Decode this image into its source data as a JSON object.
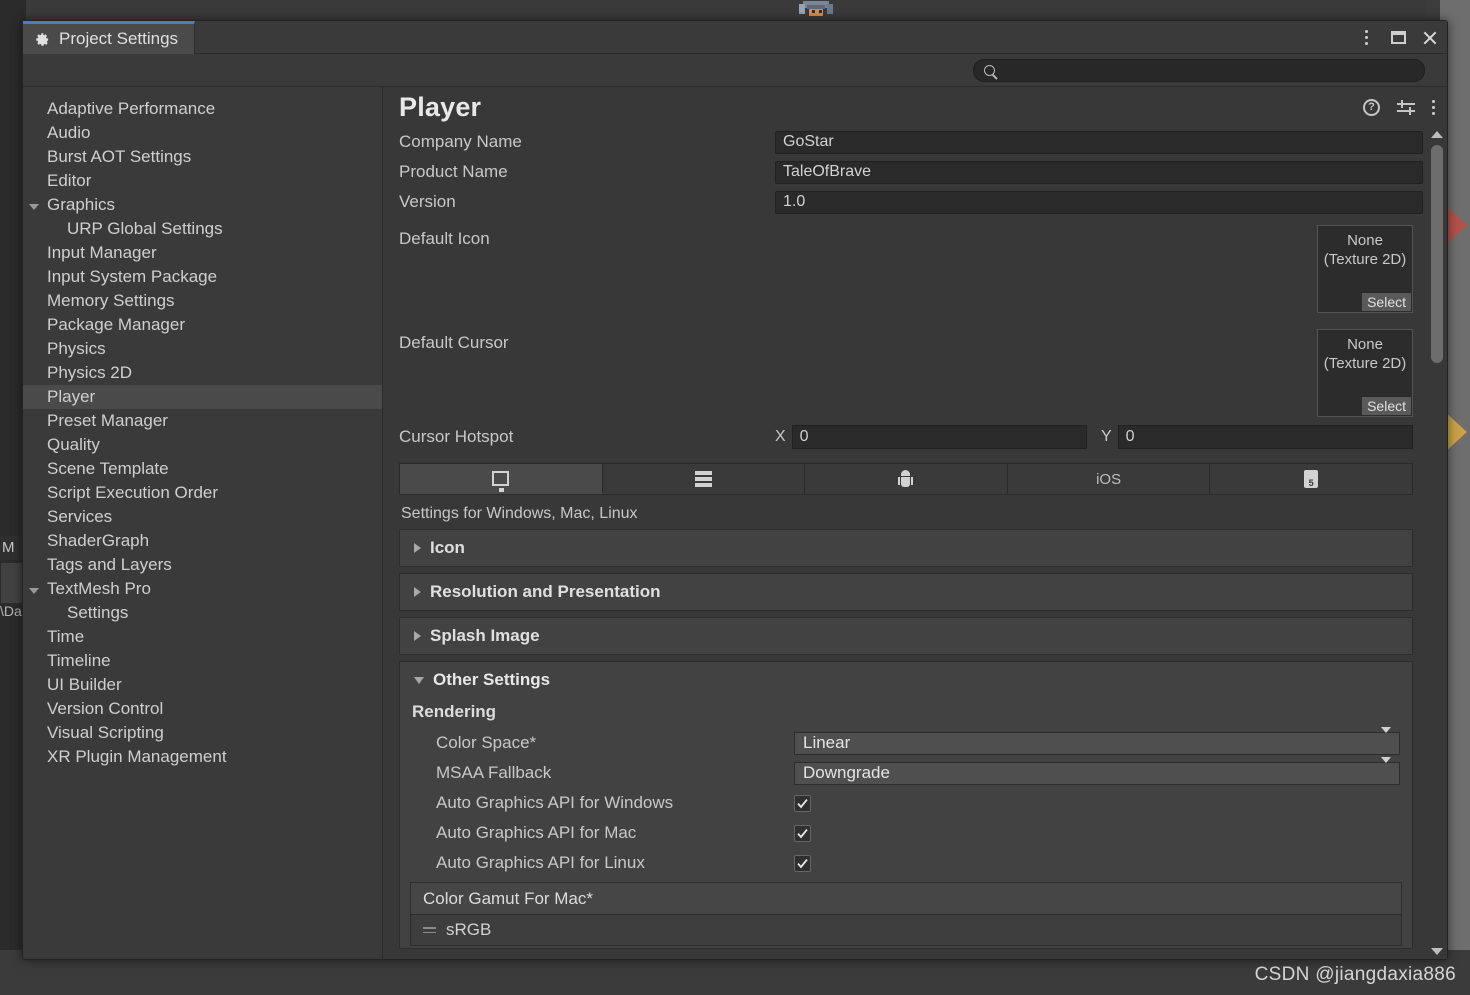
{
  "window": {
    "tab_title": "Project Settings",
    "tab_icon": "gear-icon",
    "controls": {
      "menu": "kebab-menu-icon",
      "maximize": "maximize-icon",
      "close": "close-icon"
    }
  },
  "search": {
    "placeholder": "",
    "value": "",
    "icon": "search-icon"
  },
  "sidebar": {
    "items": [
      {
        "label": "Adaptive Performance",
        "level": 0,
        "expanded": null,
        "selected": false
      },
      {
        "label": "Audio",
        "level": 0,
        "expanded": null,
        "selected": false
      },
      {
        "label": "Burst AOT Settings",
        "level": 0,
        "expanded": null,
        "selected": false
      },
      {
        "label": "Editor",
        "level": 0,
        "expanded": null,
        "selected": false
      },
      {
        "label": "Graphics",
        "level": 0,
        "expanded": true,
        "selected": false
      },
      {
        "label": "URP Global Settings",
        "level": 1,
        "expanded": null,
        "selected": false
      },
      {
        "label": "Input Manager",
        "level": 0,
        "expanded": null,
        "selected": false
      },
      {
        "label": "Input System Package",
        "level": 0,
        "expanded": null,
        "selected": false
      },
      {
        "label": "Memory Settings",
        "level": 0,
        "expanded": null,
        "selected": false
      },
      {
        "label": "Package Manager",
        "level": 0,
        "expanded": null,
        "selected": false
      },
      {
        "label": "Physics",
        "level": 0,
        "expanded": null,
        "selected": false
      },
      {
        "label": "Physics 2D",
        "level": 0,
        "expanded": null,
        "selected": false
      },
      {
        "label": "Player",
        "level": 0,
        "expanded": null,
        "selected": true
      },
      {
        "label": "Preset Manager",
        "level": 0,
        "expanded": null,
        "selected": false
      },
      {
        "label": "Quality",
        "level": 0,
        "expanded": null,
        "selected": false
      },
      {
        "label": "Scene Template",
        "level": 0,
        "expanded": null,
        "selected": false
      },
      {
        "label": "Script Execution Order",
        "level": 0,
        "expanded": null,
        "selected": false
      },
      {
        "label": "Services",
        "level": 0,
        "expanded": null,
        "selected": false
      },
      {
        "label": "ShaderGraph",
        "level": 0,
        "expanded": null,
        "selected": false
      },
      {
        "label": "Tags and Layers",
        "level": 0,
        "expanded": null,
        "selected": false
      },
      {
        "label": "TextMesh Pro",
        "level": 0,
        "expanded": true,
        "selected": false
      },
      {
        "label": "Settings",
        "level": 1,
        "expanded": null,
        "selected": false
      },
      {
        "label": "Time",
        "level": 0,
        "expanded": null,
        "selected": false
      },
      {
        "label": "Timeline",
        "level": 0,
        "expanded": null,
        "selected": false
      },
      {
        "label": "UI Builder",
        "level": 0,
        "expanded": null,
        "selected": false
      },
      {
        "label": "Version Control",
        "level": 0,
        "expanded": null,
        "selected": false
      },
      {
        "label": "Visual Scripting",
        "level": 0,
        "expanded": null,
        "selected": false
      },
      {
        "label": "XR Plugin Management",
        "level": 0,
        "expanded": null,
        "selected": false
      }
    ]
  },
  "panel": {
    "title": "Player",
    "icons": {
      "help": "help-icon",
      "preset": "preset-icon",
      "menu": "kebab-menu-icon"
    },
    "fields": {
      "company_name": {
        "label": "Company Name",
        "value": "GoStar"
      },
      "product_name": {
        "label": "Product Name",
        "value": "TaleOfBrave"
      },
      "version": {
        "label": "Version",
        "value": "1.0"
      }
    },
    "default_icon": {
      "label": "Default Icon",
      "value_line1": "None",
      "value_line2": "(Texture 2D)",
      "select_label": "Select"
    },
    "default_cursor": {
      "label": "Default Cursor",
      "value_line1": "None",
      "value_line2": "(Texture 2D)",
      "select_label": "Select"
    },
    "cursor_hotspot": {
      "label": "Cursor Hotspot",
      "x_label": "X",
      "x_value": "0",
      "y_label": "Y",
      "y_value": "0"
    },
    "platform_tabs": [
      {
        "icon": "monitor-icon",
        "label": "",
        "active": true
      },
      {
        "icon": "server-icon",
        "label": "",
        "active": false
      },
      {
        "icon": "android-icon",
        "label": "",
        "active": false
      },
      {
        "icon": "ios-icon",
        "label": "iOS",
        "active": false
      },
      {
        "icon": "html5-icon",
        "label": "",
        "active": false
      }
    ],
    "settings_for": "Settings for Windows, Mac, Linux",
    "sections": [
      {
        "label": "Icon",
        "expanded": false
      },
      {
        "label": "Resolution and Presentation",
        "expanded": false
      },
      {
        "label": "Splash Image",
        "expanded": false
      }
    ],
    "other_settings": {
      "label": "Other Settings",
      "expanded": true,
      "rendering_group": "Rendering",
      "rows": [
        {
          "type": "dropdown",
          "label": "Color Space*",
          "value": "Linear"
        },
        {
          "type": "dropdown",
          "label": "MSAA Fallback",
          "value": "Downgrade"
        },
        {
          "type": "checkbox",
          "label": "Auto Graphics API  for Windows",
          "checked": true
        },
        {
          "type": "checkbox",
          "label": "Auto Graphics API  for Mac",
          "checked": true
        },
        {
          "type": "checkbox",
          "label": "Auto Graphics API  for Linux",
          "checked": true
        }
      ],
      "color_gamut": {
        "header": "Color Gamut For Mac*",
        "items": [
          {
            "label": "sRGB",
            "handle": "drag-handle-icon"
          }
        ]
      }
    }
  },
  "watermark": "CSDN @jiangdaxia886",
  "colors": {
    "window_bg": "#383838",
    "panel_bg": "#3a3a3a",
    "accent_tab": "#4b7dbd",
    "field_bg": "#2a2a2a",
    "selected_row": "#4a4a4a",
    "arrow_red": "#b4504a",
    "arrow_yellow": "#c9a246"
  }
}
